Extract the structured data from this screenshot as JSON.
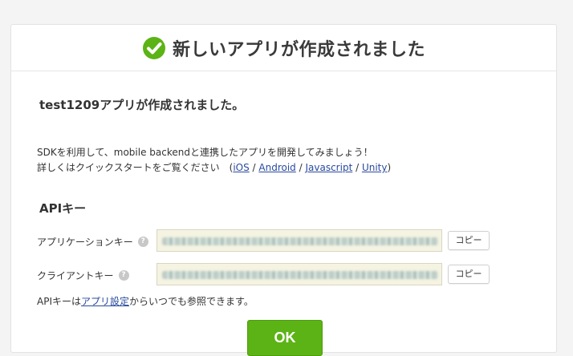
{
  "header": {
    "title": "新しいアプリが作成されました"
  },
  "created_message": "test1209アプリが作成されました。",
  "description": {
    "line1": "SDKを利用して、mobile backendと連携したアプリを開発してみましょう！",
    "line2_prefix": "詳しくはクイックスタートをご覧ください　(",
    "links": [
      "iOS",
      "Android",
      "Javascript",
      "Unity"
    ],
    "separator": " / ",
    "line2_suffix": ")"
  },
  "api_section": {
    "title": "APIキー",
    "app_key": {
      "label": "アプリケーションキー",
      "help": "?",
      "copy_label": "コピー"
    },
    "client_key": {
      "label": "クライアントキー",
      "help": "?",
      "copy_label": "コピー"
    }
  },
  "note": {
    "prefix": "APIキーは",
    "link": "アプリ設定",
    "suffix": "からいつでも参照できます。"
  },
  "ok_label": "OK",
  "colors": {
    "ok_green": "#5cb315",
    "check_green": "#5cb315",
    "link": "#2a4aa0",
    "key_field_bg": "#f5f3e2"
  }
}
